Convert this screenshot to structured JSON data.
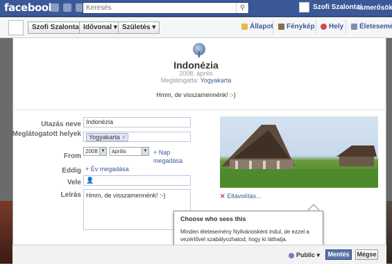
{
  "topbar": {
    "logo": "facebook",
    "search_placeholder": "Keresés",
    "user_name": "Szofi Szalontai",
    "friends_link": "Ismerősök k"
  },
  "timeline": {
    "name_button": "Szofi Szalontai",
    "timeline_button": "Idővonal ▾",
    "birth_button": "Születés ▾",
    "composer": {
      "status": "Állapot",
      "photo": "Fénykép",
      "place": "Hely",
      "life_event": "Életesemén"
    }
  },
  "event": {
    "title": "Indonézia",
    "date": "2008. április",
    "visited_prefix": "Meglátogatta:",
    "visited_place": "Yogyakarta",
    "note": "Hmm, de visszamennénk! :-)"
  },
  "form": {
    "trip_name_label": "Utazás neve",
    "trip_name_value": "Indonézia",
    "visited_label": "Meglátogatott helyek",
    "visited_tag": "Yogyakarta",
    "from_label": "From",
    "from_year": "2008",
    "from_month": "április",
    "add_day_link": "+ Nap megadása",
    "until_label": "Eddig",
    "add_year_link": "+ Év megadása",
    "with_label": "Vele",
    "desc_label": "Leírás",
    "desc_value": "Hmm, de visszamennénk! :-)"
  },
  "photo": {
    "remove_link": "Eltávolítás..."
  },
  "popover": {
    "heading": "Choose who sees this",
    "body": "Minden életesemény Nyilvánosként indul, de ezzel a vezérlővel szabályozhatod, hogy ki láthatja."
  },
  "footer": {
    "privacy": "Public ▾",
    "save": "Mentés",
    "cancel": "Mégse"
  }
}
